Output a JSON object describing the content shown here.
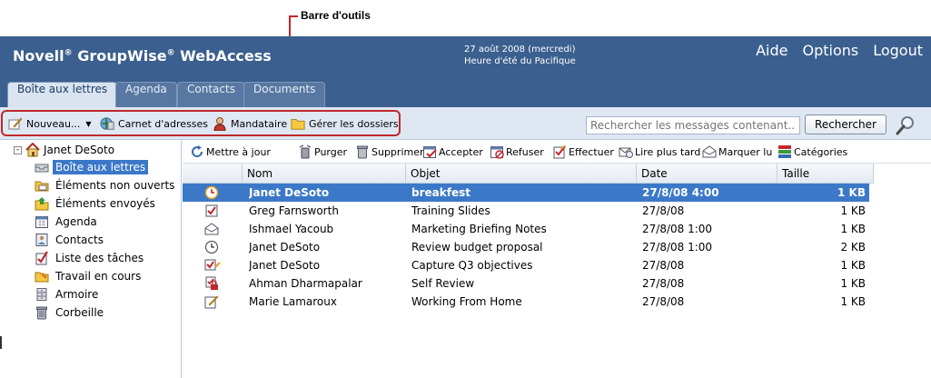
{
  "callout": {
    "label": "Barre d'outils"
  },
  "header": {
    "brand": "Novell",
    "product": "GroupWise",
    "suffix": "WebAccess",
    "reg": "®",
    "date": "27 août 2008 (mercredi)",
    "timezone": "Heure d'été du Pacifique",
    "links": {
      "help": "Aide",
      "options": "Options",
      "logout": "Logout"
    }
  },
  "tabs": [
    {
      "label": "Boîte aux lettres",
      "active": true
    },
    {
      "label": "Agenda"
    },
    {
      "label": "Contacts"
    },
    {
      "label": "Documents"
    }
  ],
  "toolbar": {
    "new": "Nouveau...",
    "address_book": "Carnet d'adresses",
    "proxy": "Mandataire",
    "manage_folders": "Gérer les dossiers",
    "search_placeholder": "Rechercher les messages contenant...",
    "search_button": "Rechercher"
  },
  "sidebar": {
    "user": "Janet DeSoto",
    "folders": [
      {
        "label": "Boîte aux lettres",
        "icon": "mailbox-icon",
        "selected": true
      },
      {
        "label": "Éléments non ouverts",
        "icon": "unopened-icon"
      },
      {
        "label": "Éléments envoyés",
        "icon": "sent-items-icon"
      },
      {
        "label": "Agenda",
        "icon": "calendar-icon"
      },
      {
        "label": "Contacts",
        "icon": "contacts-icon"
      },
      {
        "label": "Liste des tâches",
        "icon": "task-list-icon"
      },
      {
        "label": "Travail en cours",
        "icon": "work-in-progress-icon"
      },
      {
        "label": "Armoire",
        "icon": "cabinet-icon"
      },
      {
        "label": "Corbeille",
        "icon": "trash-icon"
      }
    ]
  },
  "message_toolbar": {
    "refresh": "Mettre à jour",
    "purge": "Purger",
    "delete": "Supprimer",
    "accept": "Accepter",
    "decline": "Refuser",
    "complete": "Effectuer",
    "read_later": "Lire plus tard",
    "mark_read": "Marquer lu",
    "categories": "Catégories"
  },
  "columns": {
    "name": "Nom",
    "subject": "Objet",
    "date": "Date",
    "size": "Taille"
  },
  "messages": [
    {
      "icon": "appointment-icon",
      "name": "Janet DeSoto",
      "subject": "breakfest",
      "date": "27/8/08 4:00",
      "size": "1 KB",
      "selected": true
    },
    {
      "icon": "task-icon",
      "name": "Greg Farnsworth",
      "subject": "Training Slides",
      "date": "27/8/08",
      "size": "1 KB"
    },
    {
      "icon": "mail-icon",
      "name": "Ishmael Yacoub",
      "subject": "Marketing Briefing Notes",
      "date": "27/8/08 1:00",
      "size": "1 KB"
    },
    {
      "icon": "appointment-icon",
      "name": "Janet DeSoto",
      "subject": "Review budget proposal",
      "date": "27/8/08 1:00",
      "size": "2 KB"
    },
    {
      "icon": "task-posted-icon",
      "name": "Janet DeSoto",
      "subject": "Capture Q3 objectives",
      "date": "27/8/08",
      "size": "1 KB"
    },
    {
      "icon": "secure-task-icon",
      "name": "Ahman Dharmapalar",
      "subject": "Self Review",
      "date": "27/8/08",
      "size": "1 KB"
    },
    {
      "icon": "note-icon",
      "name": "Marie Lamaroux",
      "subject": "Working From Home",
      "date": "27/8/08",
      "size": "1 KB"
    }
  ],
  "colors": {
    "header": "#3b5f8e",
    "selection": "#3b78c8",
    "callout": "#c0272d",
    "toolbar": "#dfe8f2"
  }
}
